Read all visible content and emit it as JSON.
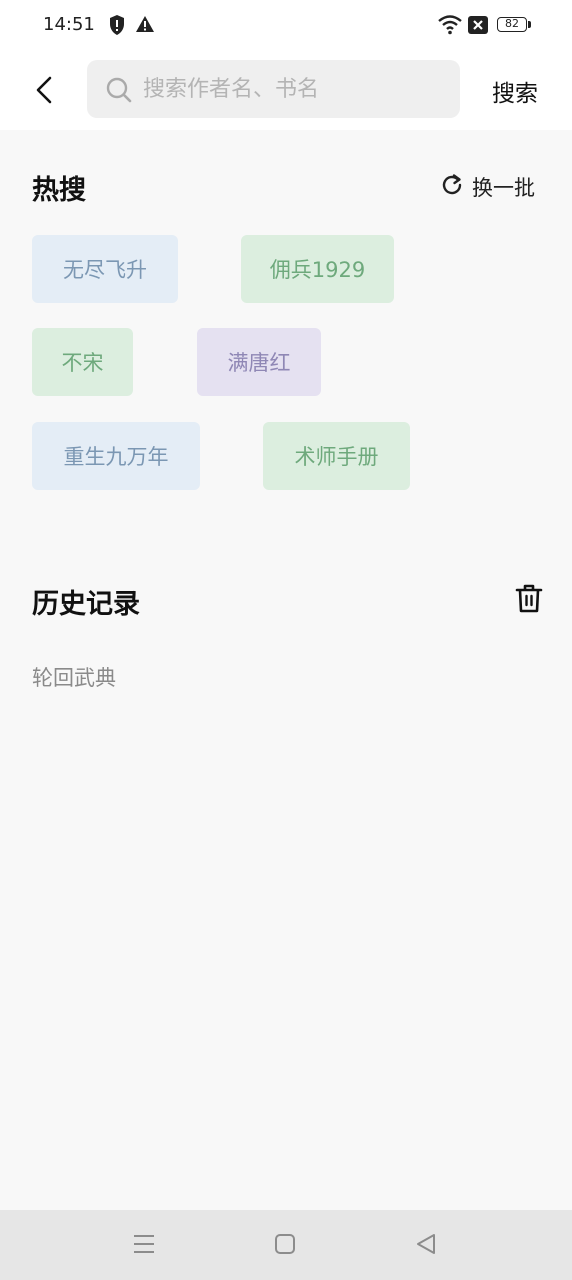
{
  "status_bar": {
    "time": "14:51",
    "icons": [
      "shield-alert-icon",
      "warning-triangle-icon",
      "wifi-icon",
      "sim-off-icon"
    ],
    "battery": "82"
  },
  "header": {
    "search_placeholder": "搜索作者名、书名",
    "search_value": "",
    "search_button": "搜索"
  },
  "hot": {
    "title": "热搜",
    "refresh_label": "换一批",
    "tags": [
      "无尽飞升",
      "佣兵1929",
      "不宋",
      "满唐红",
      "重生九万年",
      "术师手册"
    ]
  },
  "history": {
    "title": "历史记录",
    "items": [
      "轮回武典"
    ]
  },
  "nav": {
    "buttons": [
      "menu-icon",
      "home-square-icon",
      "back-triangle-icon"
    ]
  }
}
